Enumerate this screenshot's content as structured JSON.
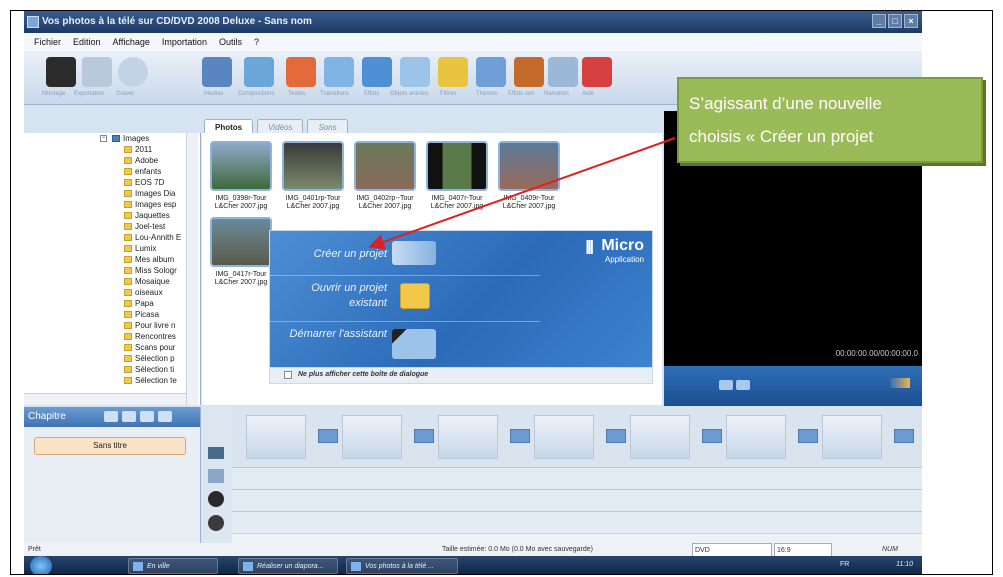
{
  "window": {
    "title": "Vos photos à la télé sur CD/DVD 2008 Deluxe - Sans nom",
    "buttons": [
      "_",
      "□",
      "×"
    ]
  },
  "menu": [
    "Fichier",
    "Edition",
    "Affichage",
    "Importation",
    "Outils",
    "?"
  ],
  "toolbar_labels": [
    "Montage",
    "Exportation",
    "Graver",
    "Medias",
    "Compositions",
    "Textes",
    "Transitions",
    "Effets",
    "Objets animés",
    "Filtres",
    "Thèmes",
    "Effets son",
    "Narration",
    "Aide"
  ],
  "tabs": [
    "Photos",
    "Vidéos",
    "Sons"
  ],
  "tree": {
    "root": "Images",
    "items": [
      "2011",
      "Adobe",
      "enfants",
      "EOS 7D",
      "Images Dia",
      "Images esp",
      "Jaquettes",
      "Joel-test",
      "Lou-Annith E",
      "Lumix",
      "Mes album",
      "Miss Sologr",
      "Mosaique",
      "oiseaux",
      "Papa",
      "Picasa",
      "Pour livre n",
      "Rencontres",
      "Scans pour",
      "Sélection p",
      "Sélection ti",
      "Sélection te"
    ]
  },
  "photos": [
    {
      "l1": "IMG_0398r-Tour",
      "l2": "L&Cher 2007.jpg"
    },
    {
      "l1": "IMG_0401rp-Tour",
      "l2": "L&Cher 2007.jpg"
    },
    {
      "l1": "IMG_0402rp--Tour",
      "l2": "L&Cher 2007.jpg"
    },
    {
      "l1": "IMG_0407r-Tour",
      "l2": "L&Cher 2007.jpg"
    },
    {
      "l1": "IMG_0409r-Tour",
      "l2": "L&Cher 2007.jpg"
    },
    {
      "l1": "IMG_0417r-Tour",
      "l2": "L&Cher 2007.jpg"
    }
  ],
  "dialog": {
    "opt1": "Créer un projet",
    "opt2": "Ouvrir un projet existant",
    "opt3": "Démarrer l'assistant",
    "logo_main": "Micro",
    "logo_sub": "Application",
    "checkbox": "Ne plus afficher cette boîte de dialogue"
  },
  "preview": {
    "timecode": "00:00:00.00/00:00:00.0"
  },
  "chapitre": {
    "title": "Chapitre",
    "item": "Sans titre"
  },
  "status": {
    "left": "Prêt",
    "size": "Taille estimée: 0.0 Mo  (0.0 Mo avec sauvegarde)",
    "format": "DVD",
    "ratio": "16:9",
    "num": "NUM"
  },
  "taskbar": {
    "tasks": [
      "En ville",
      "Réaliser un diapora...",
      "Vos photos à la télé ..."
    ],
    "lang": "FR",
    "time": "11:10"
  },
  "callout": {
    "line1": "S’agissant d’une nouvelle",
    "line2": "choisis « Créer un projet"
  },
  "colors": {
    "callout_bg": "#9bbb59",
    "dialog_bg": "#2b6ab7",
    "arrow": "#e02020"
  }
}
